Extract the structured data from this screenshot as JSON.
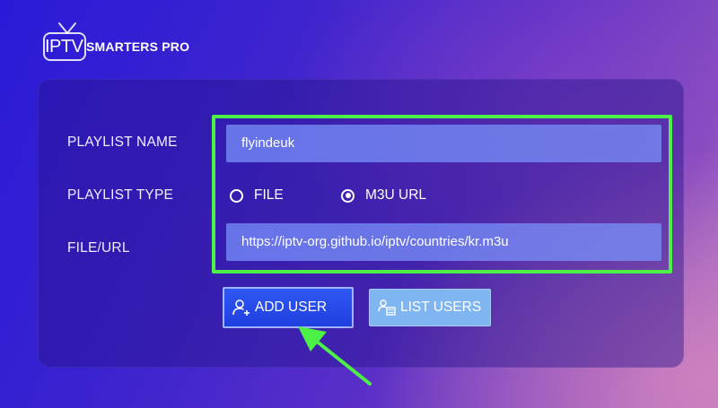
{
  "logo": {
    "iptv": "IPTV",
    "brand": "SMARTERS PRO",
    "icon": "tv-antenna-icon"
  },
  "form": {
    "playlist_name_label": "PLAYLIST NAME",
    "playlist_name_value": "flyindeuk",
    "playlist_type_label": "PLAYLIST TYPE",
    "type_options": [
      {
        "label": "FILE",
        "selected": false
      },
      {
        "label": "M3U URL",
        "selected": true
      }
    ],
    "file_url_label": "FILE/URL",
    "file_url_value": "https://iptv-org.github.io/iptv/countries/kr.m3u"
  },
  "buttons": {
    "add_user": {
      "label": "ADD USER",
      "icon": "add-user-icon"
    },
    "list_users": {
      "label": "LIST USERS",
      "icon": "list-users-icon"
    }
  },
  "colors": {
    "highlight": "#4cf046",
    "arrow": "#4cf046",
    "input_bg": "#7891fa",
    "add_button_bg": "#2f57f2",
    "list_button_bg": "#7fb6f2"
  }
}
